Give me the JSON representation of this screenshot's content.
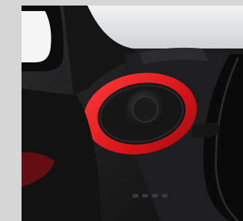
{
  "image": {
    "subject": "car-interior-air-vent",
    "accent_color": "#e0191c",
    "background_color": "#d6d6d6"
  }
}
